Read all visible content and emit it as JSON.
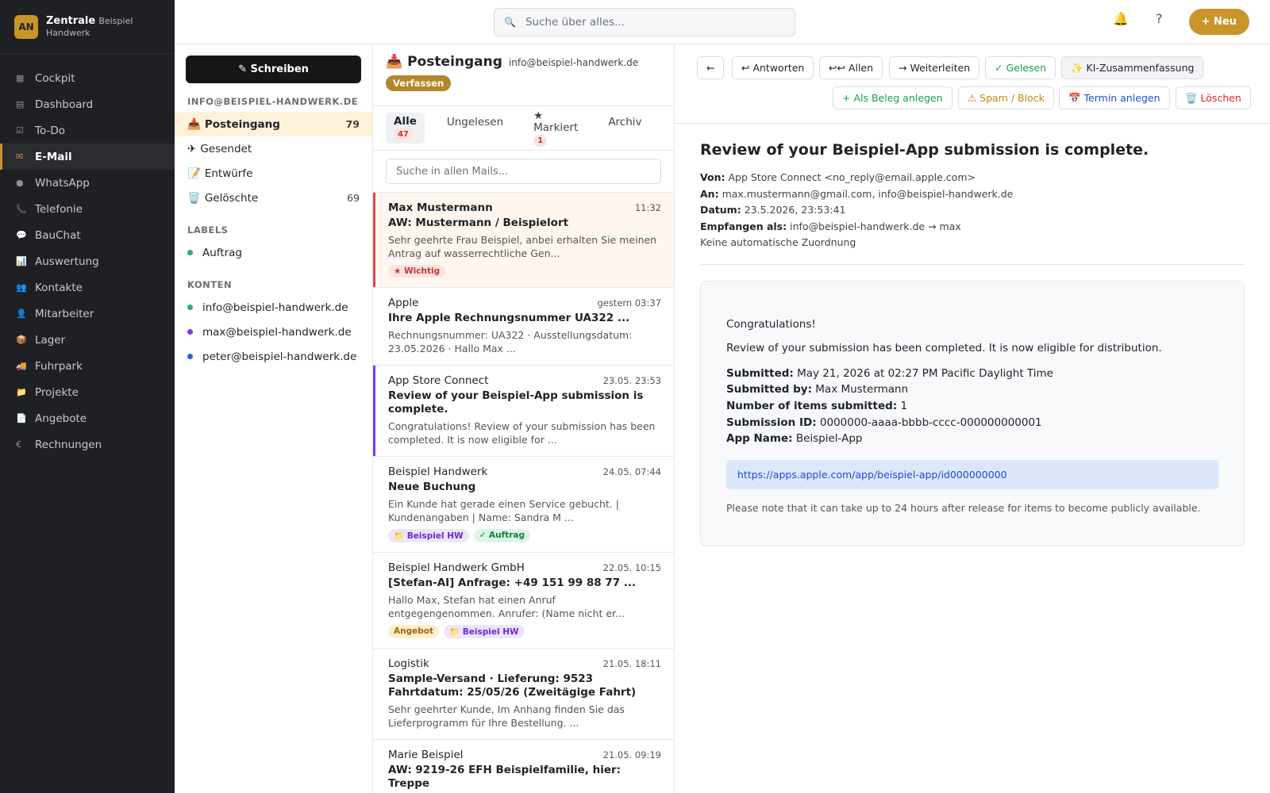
{
  "brand": {
    "avatar": "AN",
    "name": "Zentrale",
    "sub1": "Beispiel",
    "sub2": "Handwerk"
  },
  "nav": [
    {
      "icon": "▦",
      "label": "Cockpit"
    },
    {
      "icon": "▤",
      "label": "Dashboard"
    },
    {
      "icon": "☑",
      "label": "To-Do"
    },
    {
      "icon": "✉",
      "label": "E-Mail",
      "active": true
    },
    {
      "icon": "●",
      "label": "WhatsApp"
    },
    {
      "icon": "📞",
      "label": "Telefonie"
    },
    {
      "icon": "💬",
      "label": "BauChat"
    },
    {
      "icon": "📊",
      "label": "Auswertung"
    },
    {
      "icon": "👥",
      "label": "Kontakte"
    },
    {
      "icon": "👤",
      "label": "Mitarbeiter"
    },
    {
      "icon": "📦",
      "label": "Lager"
    },
    {
      "icon": "🚚",
      "label": "Fuhrpark"
    },
    {
      "icon": "📁",
      "label": "Projekte"
    },
    {
      "icon": "📄",
      "label": "Angebote"
    },
    {
      "icon": "€",
      "label": "Rechnungen"
    }
  ],
  "topbar": {
    "search_icon": "🔍",
    "search_placeholder": "Suche über alles...",
    "bell_icon": "🔔",
    "help_icon": "?",
    "new_label": "+ Neu"
  },
  "folders": {
    "compose_label": "✎ Schreiben",
    "account_title": "INFO@BEISPIEL-HANDWERK.DE",
    "items": [
      {
        "icon": "📥",
        "label": "Posteingang",
        "count": "79"
      },
      {
        "icon": "✈",
        "label": "Gesendet",
        "count": ""
      },
      {
        "icon": "📝",
        "label": "Entwürfe",
        "count": ""
      },
      {
        "icon": "🗑️",
        "label": "Gelöschte",
        "count": "69"
      }
    ],
    "labels_title": "LABELS",
    "labels": [
      {
        "label": "Auftrag",
        "color": "#22b07d"
      }
    ],
    "accounts_title": "KONTEN",
    "accounts": [
      {
        "label": "info@beispiel-handwerk.de",
        "color": "#22b07d"
      },
      {
        "label": "max@beispiel-handwerk.de",
        "color": "#7c3aed"
      },
      {
        "label": "peter@beispiel-handwerk.de",
        "color": "#2563eb"
      }
    ]
  },
  "maillist": {
    "title_icon": "📥",
    "title": "Posteingang",
    "address": "info@beispiel-handwerk.de",
    "compose_badge": "Verfassen",
    "tabs": [
      {
        "label": "Alle",
        "badge": "47"
      },
      {
        "label": "Ungelesen",
        "badge": ""
      },
      {
        "label": "★ Markiert",
        "badge": "1"
      },
      {
        "label": "Archiv",
        "badge": ""
      }
    ],
    "search_placeholder": "Suche in allen Mails...",
    "mails": [
      {
        "sender": "Max Mustermann",
        "time": "11:32",
        "subject": "AW: Mustermann / Beispielort",
        "preview": "Sehr geehrte Frau Beispiel, anbei erhalten Sie meinen Antrag auf wasserrechtliche Gen...",
        "tags": [
          "★ Wichtig"
        ]
      },
      {
        "sender": "Apple",
        "time": "gestern 03:37",
        "subject": "Ihre Apple Rechnungsnummer UA322 ...",
        "preview": "Rechnungsnummer: UA322 · Ausstellungsdatum: 23.05.2026 · Hallo Max ...",
        "tags": []
      },
      {
        "sender": "App Store Connect",
        "time": "23.05. 23:53",
        "subject": "Review of your Beispiel-App submission is complete.",
        "preview": "Congratulations! Review of your submission has been completed. It is now eligible for ...",
        "tags": []
      },
      {
        "sender": "Beispiel Handwerk",
        "time": "24.05. 07:44",
        "subject": "Neue Buchung",
        "preview": "Ein Kunde hat gerade einen Service gebucht. | Kundenangaben | Name: Sandra M ...",
        "tags": [
          "📁 Beispiel HW",
          "✓ Auftrag"
        ]
      },
      {
        "sender": "Beispiel Handwerk GmbH",
        "time": "22.05. 10:15",
        "subject": "[Stefan-AI] Anfrage: +49 151 99 88 77 ...",
        "preview": "Hallo Max, Stefan hat einen Anruf entgegengenommen. Anrufer: (Name nicht er...",
        "tags": [
          "Angebot",
          "📁 Beispiel HW"
        ]
      },
      {
        "sender": "Logistik",
        "time": "21.05. 18:11",
        "subject": "Sample-Versand · Lieferung: 9523 Fahrtdatum: 25/05/26 (Zweitägige Fahrt)",
        "preview": "Sehr geehrter Kunde, Im Anhang finden Sie das Lieferprogramm für Ihre Bestellung. ...",
        "tags": []
      },
      {
        "sender": "Marie Beispiel",
        "time": "21.05. 09:19",
        "subject": "AW: 9219-26 EFH Beispielfamilie, hier: Treppe",
        "preview": "",
        "tags": []
      }
    ]
  },
  "reader": {
    "toolbar": {
      "back": "←",
      "reply": "↩ Antworten",
      "reply_all": "↩↩ Allen",
      "forward": "→ Weiterleiten",
      "read": "✓ Gelesen",
      "ai_summary": "✨ KI-Zusammenfassung",
      "voucher": "+ Als Beleg anlegen",
      "spam": "⚠ Spam / Block",
      "appointment": "📅 Termin anlegen",
      "delete": "🗑️ Löschen"
    },
    "subject": "Review of your Beispiel-App submission is complete.",
    "meta": {
      "from_label": "Von:",
      "from": "App Store Connect <no_reply@email.apple.com>",
      "to_label": "An:",
      "to": "max.mustermann@gmail.com, info@beispiel-handwerk.de",
      "date_label": "Datum:",
      "date": "23.5.2026, 23:53:41",
      "received_label": "Empfangen als:",
      "received": "info@beispiel-handwerk.de → max",
      "assignment": "Keine automatische Zuordnung"
    },
    "body": {
      "greeting": "Congratulations!",
      "intro": "Review of your submission has been completed. It is now eligible for distribution.",
      "fields": [
        {
          "label": "Submitted:",
          "value": "May 21, 2026 at 02:27 PM Pacific Daylight Time"
        },
        {
          "label": "Submitted by:",
          "value": "Max Mustermann"
        },
        {
          "label": "Number of items submitted:",
          "value": "1"
        },
        {
          "label": "Submission ID:",
          "value": "0000000-aaaa-bbbb-cccc-000000000001"
        },
        {
          "label": "App Name:",
          "value": "Beispiel-App"
        }
      ],
      "link": "https://apps.apple.com/app/beispiel-app/id000000000",
      "note": "Please note that it can take up to 24 hours after release for items to become publicly available."
    }
  },
  "colors": {
    "accent": "#c8952a",
    "sidebar_bg": "#1f2023",
    "selected_folder": "#fdf2d9"
  }
}
